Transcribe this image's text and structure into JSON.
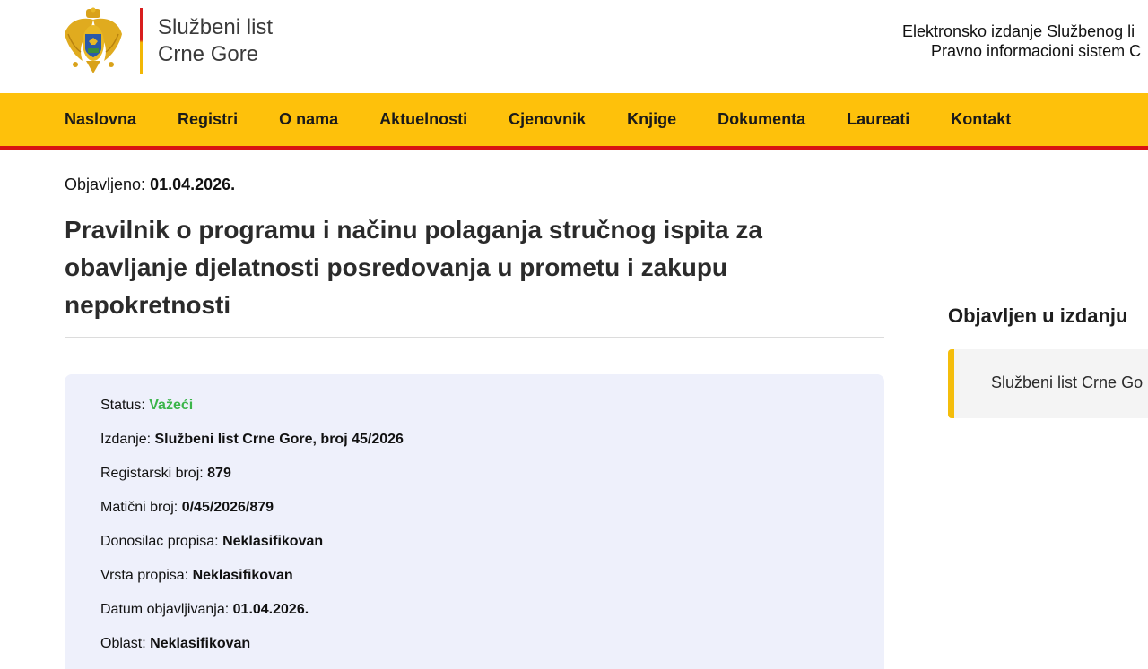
{
  "header": {
    "title_line1": "Službeni list",
    "title_line2": "Crne Gore",
    "right_line1": "Elektronsko izdanje Službenog li",
    "right_line2": "Pravno informacioni sistem C"
  },
  "nav": {
    "items": [
      {
        "label": "Naslovna"
      },
      {
        "label": "Registri"
      },
      {
        "label": "O nama"
      },
      {
        "label": "Aktuelnosti"
      },
      {
        "label": "Cjenovnik"
      },
      {
        "label": "Knjige"
      },
      {
        "label": "Dokumenta"
      },
      {
        "label": "Laureati"
      },
      {
        "label": "Kontakt"
      }
    ]
  },
  "article": {
    "published_label": "Objavljeno:",
    "published_date": "01.04.2026.",
    "title": "Pravilnik o programu i načinu polaganja stručnog ispita za obavljanje djelatnosti posredovanja u prometu i zakupu nepokretnosti"
  },
  "details": {
    "status_label": "Status:",
    "status_value": "Važeći",
    "edition_label": "Izdanje:",
    "edition_value": "Službeni list Crne Gore, broj 45/2026",
    "reg_label": "Registarski broj:",
    "reg_value": "879",
    "master_label": "Matični broj:",
    "master_value": "0/45/2026/879",
    "issuer_label": "Donosilac propisa:",
    "issuer_value": "Neklasifikovan",
    "type_label": "Vrsta propisa:",
    "type_value": "Neklasifikovan",
    "date_label": "Datum objavljivanja:",
    "date_value": "01.04.2026.",
    "area_label": "Oblast:",
    "area_value": "Neklasifikovan"
  },
  "sidebar": {
    "heading": "Objavljen u izdanju",
    "card_text": "Službeni list Crne Go"
  },
  "colors": {
    "nav_bg": "#fec10b",
    "nav_underline": "#d81212",
    "status_green": "#3bb54a",
    "info_bg": "#eef0fb"
  }
}
